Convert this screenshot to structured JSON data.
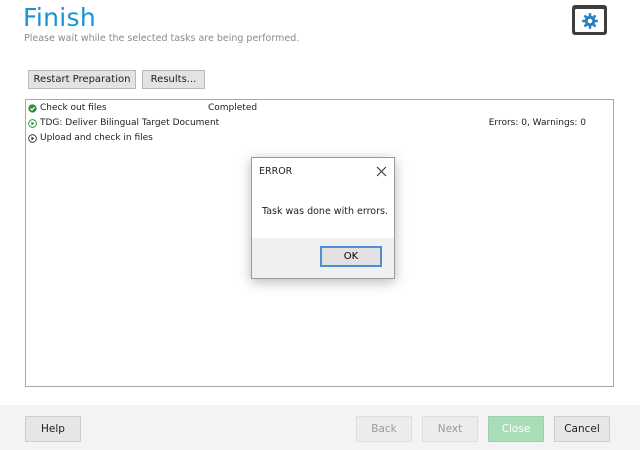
{
  "header": {
    "title": "Finish",
    "subtitle": "Please wait while the selected tasks are being performed.",
    "settings_icon": "gear-icon"
  },
  "toolbar": {
    "restart_label": "Restart Preparation",
    "results_label": "Results..."
  },
  "tasks": [
    {
      "icon": "check-circle-icon",
      "name": "Check out files",
      "status": "Completed",
      "result": ""
    },
    {
      "icon": "play-circle-icon",
      "name": "TDG: Deliver Bilingual Target Document",
      "status": "",
      "result": "Errors: 0, Warnings: 0"
    },
    {
      "icon": "play-circle-icon",
      "name": "Upload and check in files",
      "status": "",
      "result": ""
    }
  ],
  "dialog": {
    "title": "ERROR",
    "message": "Task was done with errors.",
    "ok_label": "OK"
  },
  "footer": {
    "help_label": "Help",
    "back_label": "Back",
    "next_label": "Next",
    "close_label": "Close",
    "cancel_label": "Cancel"
  },
  "colors": {
    "title_blue": "#1a93d2",
    "success_green": "#2e8b3a",
    "close_button_green": "#a9ddb8",
    "dialog_focus_blue": "#4c8fd6"
  }
}
